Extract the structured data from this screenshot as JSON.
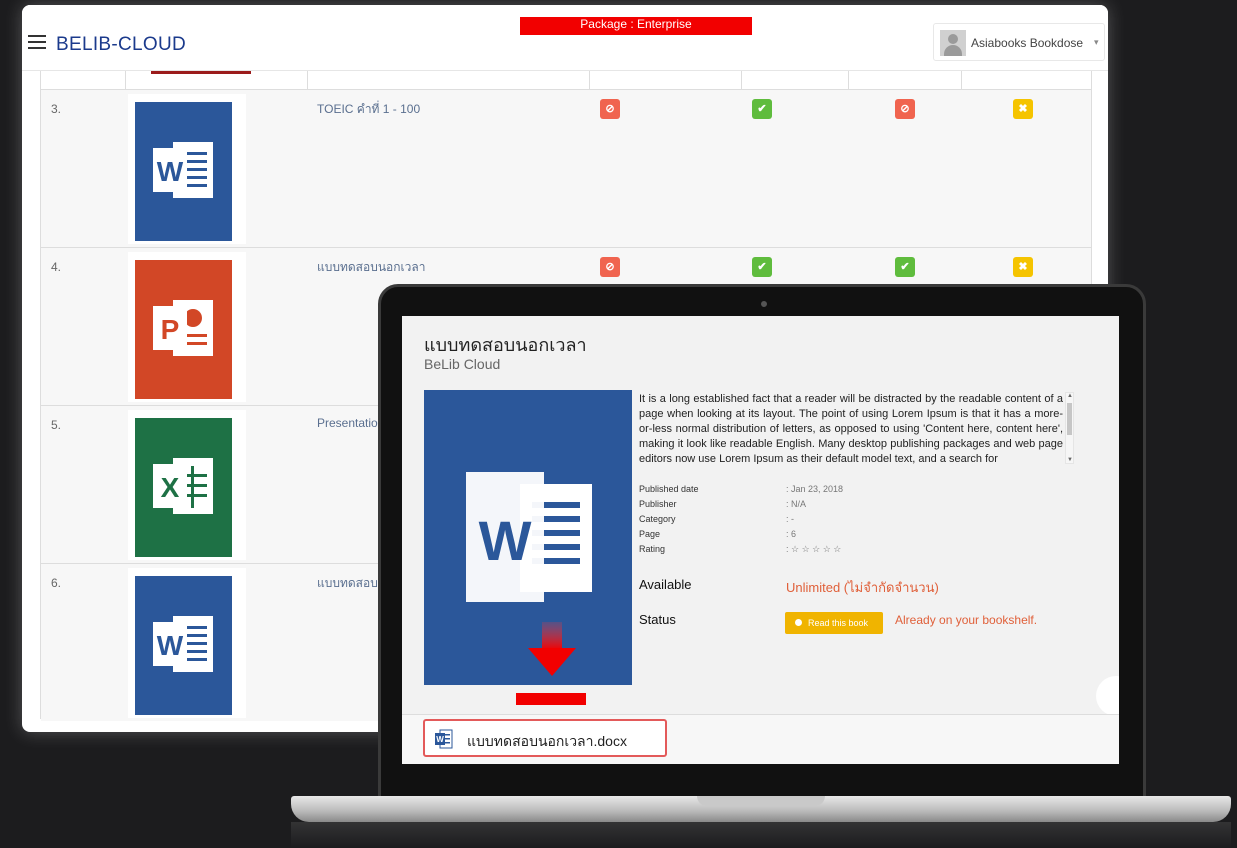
{
  "header": {
    "brand": "BELIB-CLOUD",
    "package": "Package : Enterprise",
    "user_name": "Asiabooks Bookdose",
    "user_caret": "▾"
  },
  "rows": [
    {
      "num": "3.",
      "title": "TOEIC คำที่ 1 - 100",
      "icon": "word-icon",
      "badges": [
        "block",
        "check",
        "block",
        "x"
      ]
    },
    {
      "num": "4.",
      "title": "แบบทดสอบนอกเวลา",
      "icon": "powerpoint-icon",
      "badges": [
        "block",
        "check",
        "check",
        "x"
      ]
    },
    {
      "num": "5.",
      "title": "Presentatio",
      "icon": "excel-icon",
      "badges": []
    },
    {
      "num": "6.",
      "title": "แบบทดสอบ",
      "icon": "word-icon",
      "badges": []
    }
  ],
  "badge_glyphs": {
    "block": "⊘",
    "check": "✔",
    "x": "✖"
  },
  "colors": {
    "brand": "#1b3a8c",
    "package_bg": "#f20000",
    "word": "#2b579a",
    "powerpoint": "#d24726",
    "excel": "#1e7145",
    "accent_orange": "#e0603a",
    "button_yellow": "#f0b400"
  },
  "detail": {
    "title": "แบบทดสอบนอกเวลา",
    "subtitle": "BeLib Cloud",
    "description": "It is a long established fact that a reader will be distracted by the readable content of a page when looking at its layout. The point of using Lorem Ipsum is that it has a more-or-less normal distribution of letters, as opposed to using 'Content here, content here', making it look like readable English. Many desktop publishing packages and web page editors now use Lorem Ipsum as their default model text, and a search for",
    "meta": [
      {
        "label": "Published date",
        "value": ": Jan 23, 2018"
      },
      {
        "label": "Publisher",
        "value": ": N/A"
      },
      {
        "label": "Category",
        "value": ": -"
      },
      {
        "label": "Page",
        "value": ": 6"
      },
      {
        "label": "Rating",
        "value": ": ☆ ☆ ☆ ☆ ☆"
      }
    ],
    "available_label": "Available",
    "available_value": "Unlimited (ไม่จำกัดจำนวน)",
    "status_label": "Status",
    "read_button": "Read this book",
    "status_value": "Already on your bookshelf.",
    "download_filename": "แบบทดสอบนอกเวลา.docx"
  }
}
